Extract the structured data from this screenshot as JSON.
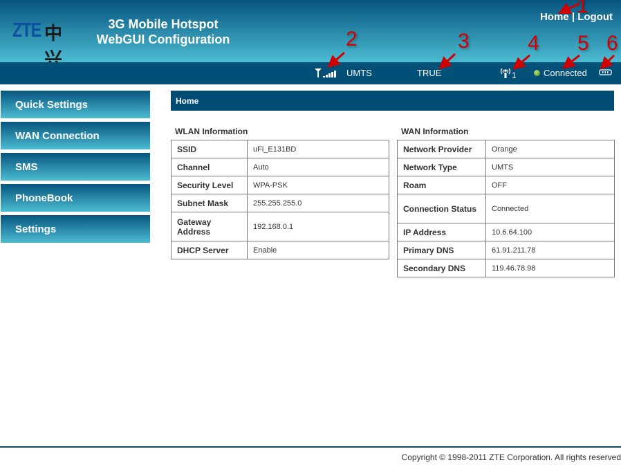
{
  "header": {
    "logo_text": "ZTE中兴",
    "title_line1": "3G Mobile Hotspot",
    "title_line2": "WebGUI Configuration",
    "links": {
      "home": "Home",
      "separator": "|",
      "logout": "Logout"
    }
  },
  "statusbar": {
    "signal_icon": "signal-strength-icon",
    "network_type": "UMTS",
    "sim_status": "TRUE",
    "wifi_icon": "wifi-antenna-icon",
    "wifi_clients": "1",
    "connection_status": "Connected",
    "status_color": "#6aa832",
    "battery_icon": "battery-icon"
  },
  "sidebar": {
    "items": [
      {
        "label": "Quick Settings"
      },
      {
        "label": "WAN Connection"
      },
      {
        "label": "SMS"
      },
      {
        "label": "PhoneBook"
      },
      {
        "label": "Settings"
      }
    ]
  },
  "main": {
    "breadcrumb": "Home",
    "wlan": {
      "title": "WLAN Information",
      "rows": [
        {
          "label": "SSID",
          "value": "uFi_E131BD"
        },
        {
          "label": "Channel",
          "value": "Auto"
        },
        {
          "label": "Security Level",
          "value": "WPA-PSK"
        },
        {
          "label": "Subnet Mask",
          "value": "255.255.255.0"
        },
        {
          "label": "Gateway Address",
          "value": "192.168.0.1"
        },
        {
          "label": "DHCP Server",
          "value": "Enable"
        }
      ]
    },
    "wan": {
      "title": "WAN Information",
      "rows": [
        {
          "label": "Network Provider",
          "value": "Orange"
        },
        {
          "label": "Network Type",
          "value": "UMTS"
        },
        {
          "label": "Roam",
          "value": "OFF"
        },
        {
          "label": "Connection Status",
          "value": "Connected"
        },
        {
          "label": "IP Address",
          "value": "10.6.64.100"
        },
        {
          "label": "Primary DNS",
          "value": "61.91.211.78"
        },
        {
          "label": "Secondary DNS",
          "value": "119.46.78.98"
        }
      ]
    }
  },
  "footer": {
    "copyright": "Copyright © 1998-2011 ZTE Corporation. All rights reserved"
  },
  "annotations": [
    "1",
    "2",
    "3",
    "4",
    "5",
    "6"
  ],
  "colors": {
    "header_dark": "#07557f",
    "header_light": "#4cbcd2",
    "bar": "#024f77",
    "annotation": "#d00000"
  }
}
